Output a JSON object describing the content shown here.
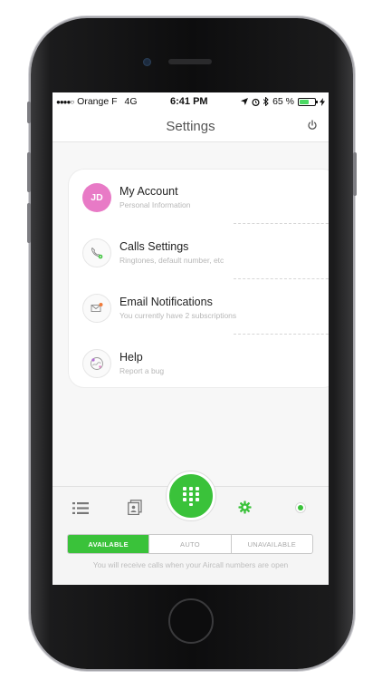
{
  "status_bar": {
    "carrier": "Orange F",
    "network": "4G",
    "time": "6:41 PM",
    "battery": "65 %",
    "battery_level": 0.65
  },
  "header": {
    "title": "Settings",
    "power_icon": "power-icon"
  },
  "settings": [
    {
      "title": "My Account",
      "subtitle": "Personal Information",
      "avatar": "JD",
      "avatar_color": "#e87ac6"
    },
    {
      "title": "Calls Settings",
      "subtitle": "Ringtones, default number, etc",
      "icon": "phone-gear-icon"
    },
    {
      "title": "Email Notifications",
      "subtitle": "You currently have 2 subscriptions",
      "icon": "envelope-notification-icon"
    },
    {
      "title": "Help",
      "subtitle": "Report a bug",
      "icon": "help-map-icon"
    }
  ],
  "tabbar": {
    "icons": [
      "list-icon",
      "contacts-icon",
      "dialpad-icon",
      "settings-gear-icon",
      "online-status-icon"
    ]
  },
  "availability": {
    "options": [
      "AVAILABLE",
      "AUTO",
      "UNAVAILABLE"
    ],
    "selected": "AVAILABLE",
    "hint": "You will receive calls when your Aircall numbers are open"
  },
  "colors": {
    "accent_green": "#3ac23a",
    "avatar_pink": "#e87ac6"
  }
}
